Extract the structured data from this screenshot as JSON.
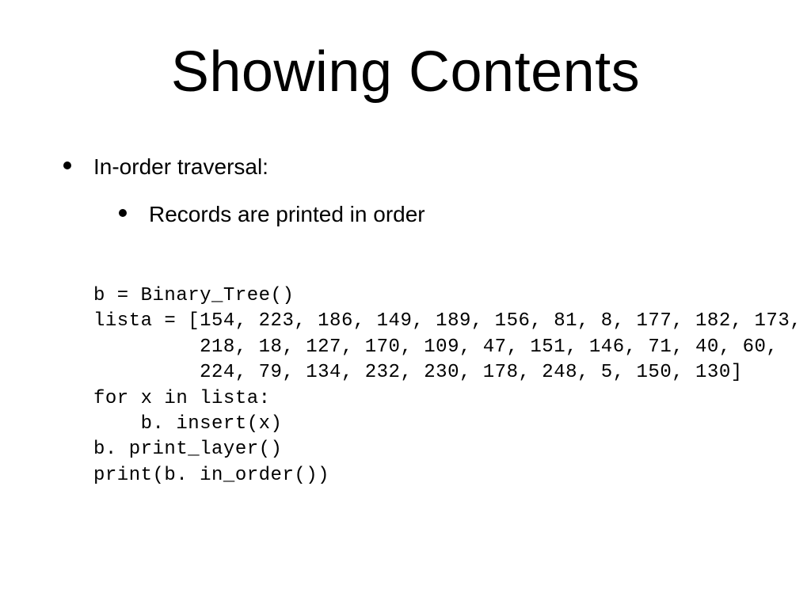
{
  "slide": {
    "title": "Showing Contents",
    "bullet1": "In-order traversal:",
    "bullet2": "Records are printed in order",
    "code": "b = Binary_Tree()\nlista = [154, 223, 186, 149, 189, 156, 81, 8, 177, 182, 173,\n         218, 18, 127, 170, 109, 47, 151, 146, 71, 40, 60,\n         224, 79, 134, 232, 230, 178, 248, 5, 150, 130]\nfor x in lista:\n    b. insert(x)\nb. print_layer()\nprint(b. in_order())"
  }
}
